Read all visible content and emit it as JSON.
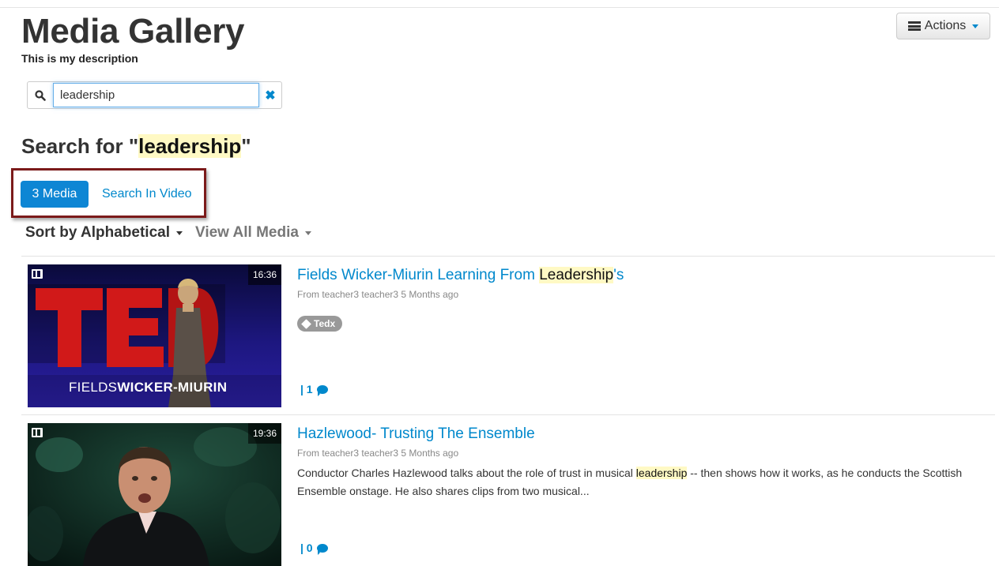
{
  "header": {
    "title": "Media Gallery",
    "description": "This is my description",
    "actions_label": "Actions"
  },
  "search": {
    "value": "leadership",
    "placeholder": "",
    "heading_prefix": "Search for \"",
    "heading_term": "leadership",
    "heading_suffix": "\""
  },
  "tabs": {
    "active": "3 Media",
    "other": "Search In Video"
  },
  "sort": {
    "sort_label": "Sort by Alphabetical",
    "view_label": "View All Media"
  },
  "items": [
    {
      "title_before": "Fields Wicker-Miurin Learning From ",
      "title_highlight": "Leadership",
      "title_after": "'s",
      "meta": "From teacher3 teacher3 5 Months ago",
      "duration": "16:36",
      "tag": "Tedx",
      "comments": "| 1",
      "thumb_text_light": "FIELDS",
      "thumb_text_bold": "WICKER-MIURIN"
    },
    {
      "title": "Hazlewood- Trusting The Ensemble",
      "meta": "From teacher3 teacher3 5 Months ago",
      "duration": "19:36",
      "desc_before": "Conductor Charles Hazlewood talks about the role of trust in musical ",
      "desc_highlight": "leadership",
      "desc_after": " -- then shows how it works, as he conducts the Scottish Ensemble onstage. He also shares clips from two musical...",
      "comments": "| 0"
    }
  ],
  "colors": {
    "accent": "#0088cc",
    "active_tab": "#0e86d4",
    "highlight_box": "#7b1a1a",
    "highlight_text_bg": "#fff9c4"
  }
}
